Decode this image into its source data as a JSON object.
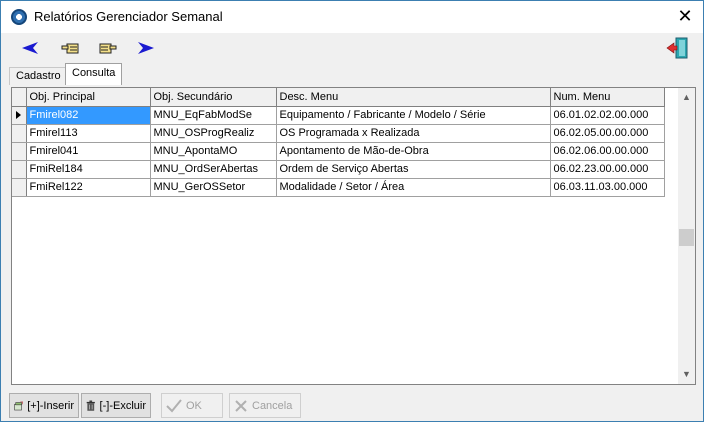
{
  "window": {
    "title": "Relatórios Gerenciador Semanal"
  },
  "toolbar": {
    "icons": [
      "arrow-left-blue-icon",
      "hand-point-left-icon",
      "hand-point-right-icon",
      "arrow-right-blue-icon",
      "exit-door-icon"
    ]
  },
  "tabs": [
    {
      "label": "Cadastro",
      "active": false
    },
    {
      "label": "Consulta",
      "active": true
    }
  ],
  "grid": {
    "columns": [
      "Obj. Principal",
      "Obj. Secundário",
      "Desc. Menu",
      "Num. Menu"
    ],
    "rows": [
      [
        "Fmirel082",
        "MNU_EqFabModSe",
        "Equipamento / Fabricante / Modelo / Série",
        "06.01.02.02.00.000"
      ],
      [
        "Fmirel113",
        "MNU_OSProgRealiz",
        "OS Programada x Realizada",
        "06.02.05.00.00.000"
      ],
      [
        "Fmirel041",
        "MNU_ApontaMO",
        "Apontamento de Mão-de-Obra",
        "06.02.06.00.00.000"
      ],
      [
        "FmiRel184",
        "MNU_OrdSerAbertas",
        "Ordem de Serviço Abertas",
        "06.02.23.00.00.000"
      ],
      [
        "FmiRel122",
        "MNU_GerOSSetor",
        "Modalidade / Setor / Área",
        "06.03.11.03.00.000"
      ]
    ],
    "selected_row": 0,
    "selection_color": "#3399ff"
  },
  "buttons": {
    "insert": "[+]-Inserir",
    "delete": "[-]-Excluir",
    "ok": "OK",
    "cancel": "Cancela"
  }
}
